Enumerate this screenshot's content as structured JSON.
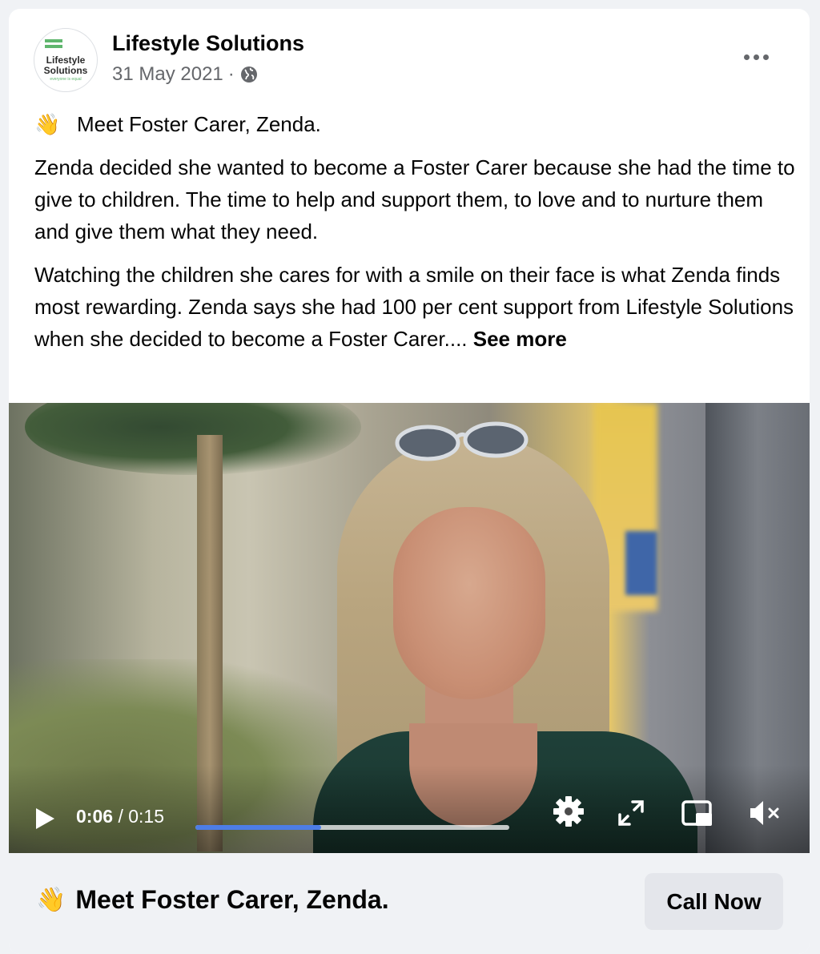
{
  "post": {
    "page_name": "Lifestyle Solutions",
    "date": "31 May 2021",
    "separator": "·",
    "privacy_icon": "globe-icon",
    "more_icon": "more-options-icon",
    "avatar": {
      "logo_line1": "Lifestyle",
      "logo_line2": "Solutions",
      "logo_tagline": "everyone is equal"
    },
    "body": {
      "wave_emoji": "👋",
      "headline": "Meet Foster Carer, Zenda.",
      "paragraph1": "Zenda decided she wanted to become a Foster Carer because she had the time to give to children. The time to help and support them, to love and to nurture them and give them what they need.",
      "paragraph2": "Watching the children she cares for with a smile on their face is what Zenda finds most rewarding. Zenda says she had 100 per cent support from Lifestyle Solutions when she decided to become a Foster Carer....",
      "see_more": "See more"
    }
  },
  "video": {
    "current_time": "0:06",
    "time_separator": "/",
    "duration": "0:15",
    "progress_fraction": 0.4,
    "accent_color": "#4d7de6",
    "icons": [
      "play-icon",
      "gear-icon",
      "fullscreen-icon",
      "picture-in-picture-icon",
      "muted-speaker-icon"
    ]
  },
  "footer": {
    "wave_emoji": "👋",
    "title": "Meet Foster Carer, Zenda.",
    "cta_label": "Call Now"
  }
}
